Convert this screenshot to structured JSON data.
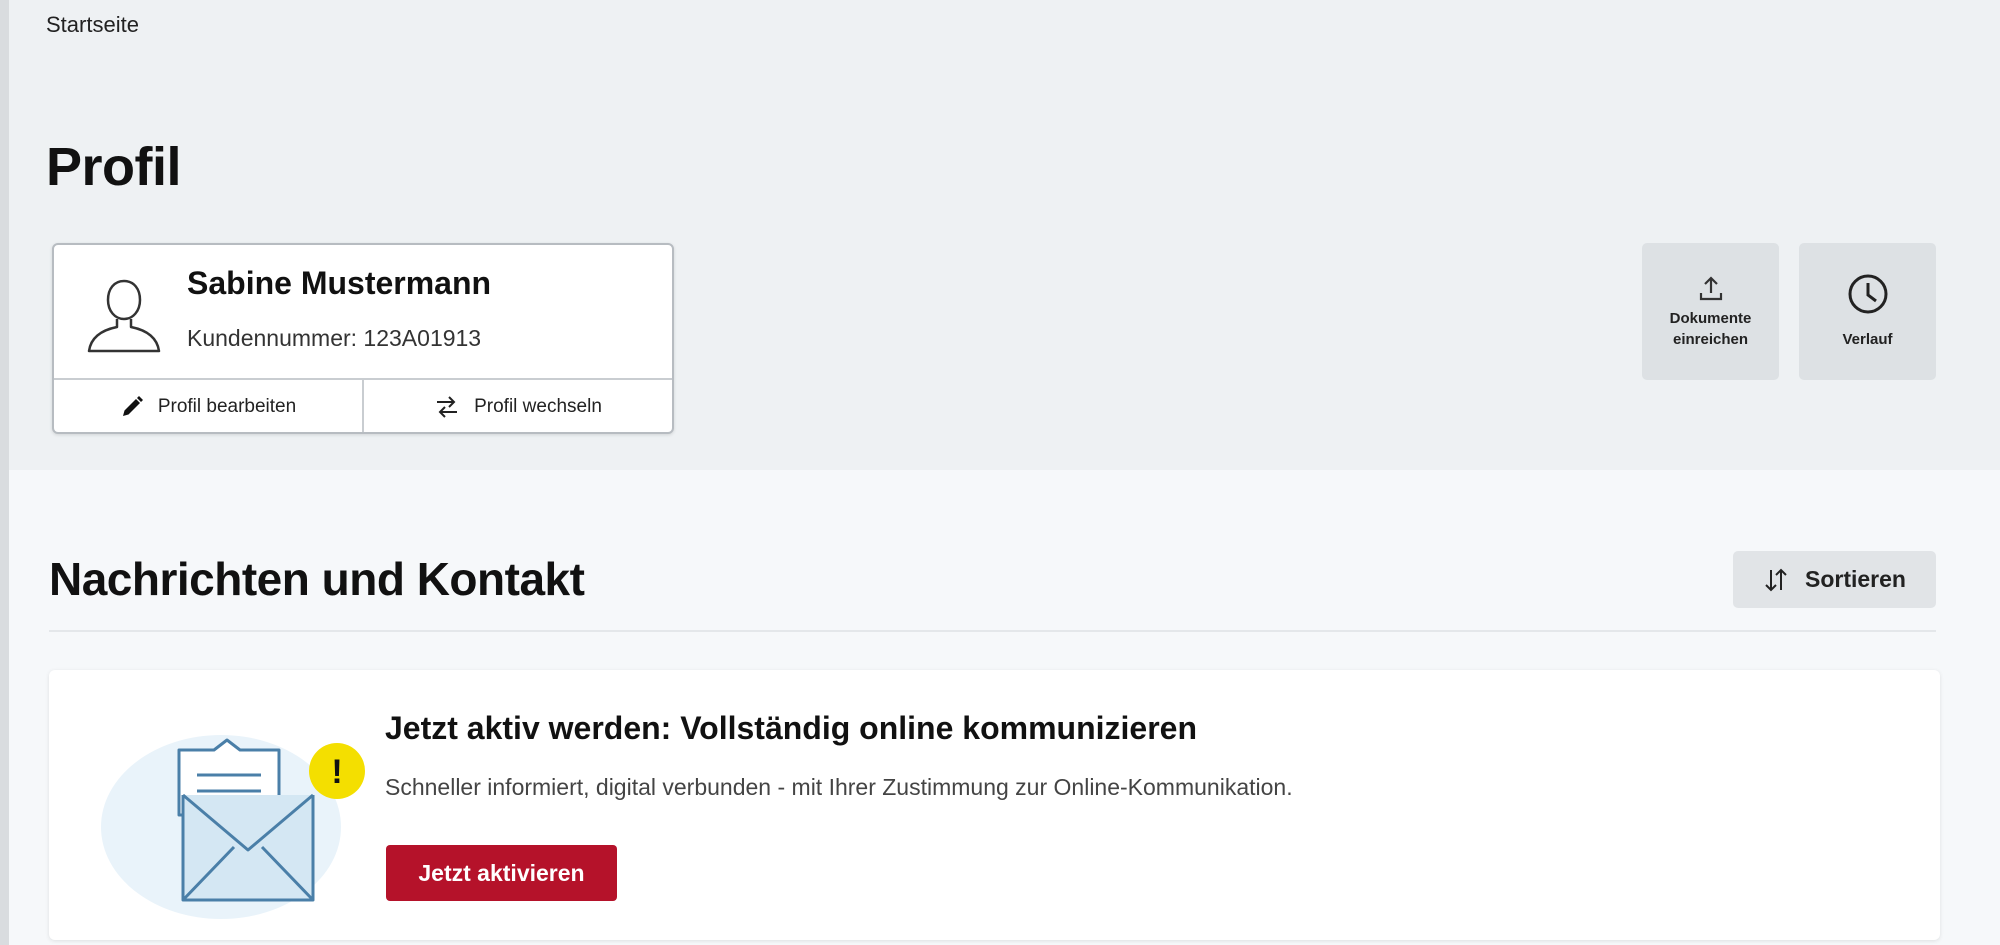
{
  "breadcrumb": {
    "label": "Startseite"
  },
  "page": {
    "title": "Profil"
  },
  "profile": {
    "name": "Sabine Mustermann",
    "customer_number": "Kundennummer: 123A01913",
    "edit_label": "Profil bearbeiten",
    "switch_label": "Profil wechseln"
  },
  "tiles": {
    "documents_line1": "Dokumente",
    "documents_line2": "einreichen",
    "history": "Verlauf"
  },
  "messages": {
    "title": "Nachrichten und Kontakt",
    "sort_label": "Sortieren"
  },
  "info_card": {
    "title": "Jetzt aktiv werden: Vollständig online kommunizieren",
    "text": "Schneller informiert, digital verbunden - mit Ihrer Zustimmung zur Online-Kommunikation.",
    "button_label": "Jetzt aktivieren",
    "badge": "!"
  },
  "colors": {
    "primary": "#b5122a",
    "illustration_blue": "#4a7fa8",
    "badge_yellow": "#f4df00",
    "band_background": "#eef1f3"
  },
  "icons": [
    "user-icon",
    "pencil-icon",
    "switch-icon",
    "upload-icon",
    "clock-icon",
    "sort-icon",
    "envelope-icon"
  ]
}
